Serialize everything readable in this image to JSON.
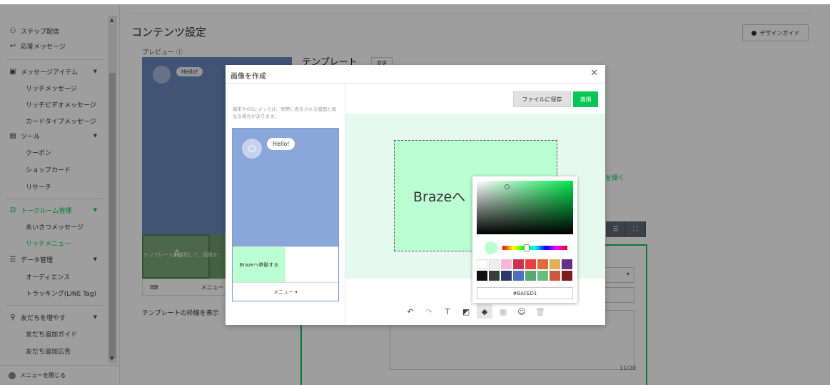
{
  "sidebar": {
    "items": [
      {
        "label": "ステップ配信",
        "icon": "tree-icon"
      },
      {
        "label": "応答メッセージ",
        "icon": "reply-icon"
      },
      {
        "label": "メッセージアイテム",
        "icon": "image-icon"
      },
      {
        "label": "ツール",
        "icon": "toolbox-icon"
      },
      {
        "label": "トークルーム管理",
        "icon": "chat-room-icon"
      },
      {
        "label": "データ管理",
        "icon": "database-icon"
      },
      {
        "label": "友だちを増やす",
        "icon": "add-friend-icon"
      }
    ],
    "sub_message": [
      "リッチメッセージ",
      "リッチビデオメッセージ",
      "カードタイプメッセージ"
    ],
    "sub_tools": [
      "クーポン",
      "ショップカード",
      "リサーチ"
    ],
    "sub_talkroom": [
      "あいさつメッセージ",
      "リッチメニュー"
    ],
    "sub_data": [
      "オーディエンス",
      "トラッキング(LINE Tag)"
    ],
    "sub_friends": [
      "友だち追加ガイド",
      "友だち追加広告"
    ],
    "close_menu": "メニューを閉じる"
  },
  "main": {
    "page_title": "コンテンツ設定",
    "design_guide": "デザインガイド",
    "preview_label": "プレビュー ⓘ",
    "preview_bubble": "Hello!",
    "template_title": "テンプレート",
    "change_btn": "変更",
    "rich_hint": "テンプレートを選択して、画像を",
    "menu_label": "メニュー ▾",
    "template_border_label": "テンプレートの枠線を表示",
    "open_link": "を開く",
    "counter": "11/20"
  },
  "modal": {
    "title": "画像を作成",
    "notice": "端末やOSによっては、実際に表示される画面と異なる場合があります。",
    "bubble": "Hello!",
    "rich_cell_label": "Brazeへ移動する",
    "menu_label": "メニュー ▾",
    "save_button": "ファイルに保存",
    "apply_button": "適用",
    "canvas_text": "Brazeへ"
  },
  "picker": {
    "hex_value": "#BAFED1",
    "current_color": "#BAFED1",
    "swatches": [
      "#ffffff",
      "#eeeeee",
      "#f7b6d9",
      "#c9344e",
      "#e84040",
      "#e06a3c",
      "#dcb054",
      "#6a2e86",
      "#111111",
      "#34403d",
      "#2a3b6a",
      "#4f6fc0",
      "#59a873",
      "#67bd7a",
      "#c85a45",
      "#7a1e1e"
    ]
  },
  "colors": {
    "accent": "#06C755",
    "overlay": "rgba(0,0,0,0.38)"
  }
}
